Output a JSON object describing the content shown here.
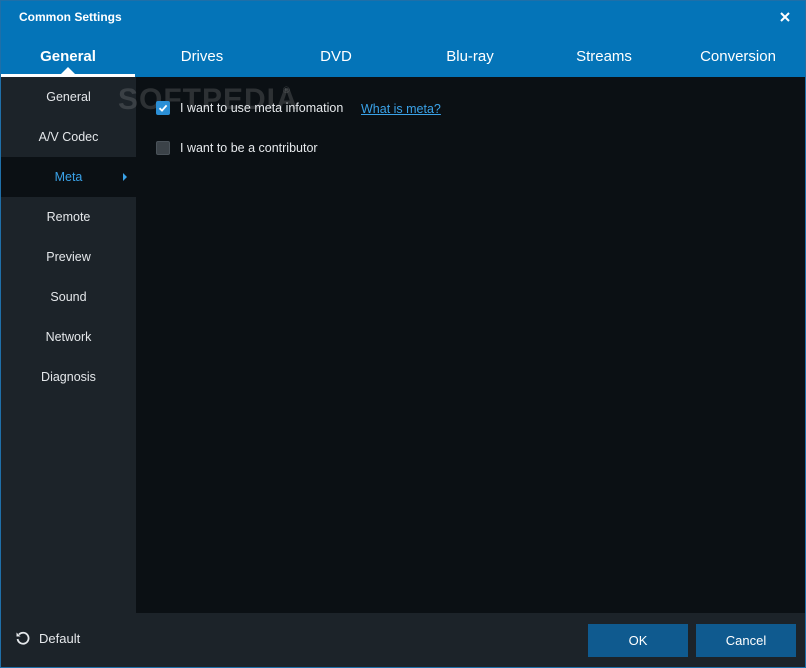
{
  "window": {
    "title": "Common Settings"
  },
  "tabs": [
    {
      "label": "General",
      "active": true
    },
    {
      "label": "Drives"
    },
    {
      "label": "DVD"
    },
    {
      "label": "Blu-ray"
    },
    {
      "label": "Streams"
    },
    {
      "label": "Conversion"
    }
  ],
  "sidebar": {
    "items": [
      {
        "label": "General"
      },
      {
        "label": "A/V Codec"
      },
      {
        "label": "Meta",
        "active": true
      },
      {
        "label": "Remote"
      },
      {
        "label": "Preview"
      },
      {
        "label": "Sound"
      },
      {
        "label": "Network"
      },
      {
        "label": "Diagnosis"
      }
    ]
  },
  "content": {
    "watermark": "SOFTPEDIA",
    "watermark_mark": "®",
    "options": [
      {
        "label": "I want to use meta infomation",
        "checked": true
      },
      {
        "label": "I want to be a contributor",
        "checked": false
      }
    ],
    "help_link": "What is meta?"
  },
  "footer": {
    "default_label": "Default",
    "ok_label": "OK",
    "cancel_label": "Cancel"
  },
  "colors": {
    "accent": "#0474b8",
    "link": "#3aa2e8",
    "button": "#0f5a8f",
    "sidebar_bg": "#1c2329",
    "content_bg": "#0b1014"
  }
}
